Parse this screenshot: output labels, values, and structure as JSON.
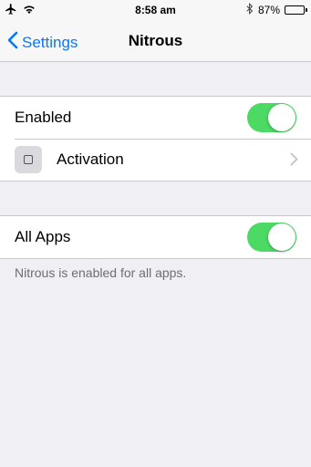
{
  "status_bar": {
    "time": "8:58 am",
    "battery_text": "87%",
    "battery_level": 0.87,
    "icons": [
      "airplane-icon",
      "wifi-icon",
      "bluetooth-icon",
      "battery-icon"
    ]
  },
  "nav": {
    "back_label": "Settings",
    "title": "Nitrous",
    "accent": "#007aff"
  },
  "group1": {
    "enabled_label": "Enabled",
    "enabled_on": true,
    "activation_label": "Activation"
  },
  "group2": {
    "all_apps_label": "All Apps",
    "all_apps_on": true
  },
  "footer": {
    "note": "Nitrous is enabled for all apps."
  },
  "colors": {
    "toggle_on": "#4cd964",
    "background": "#efeff4",
    "separator": "#c8c7cc"
  }
}
